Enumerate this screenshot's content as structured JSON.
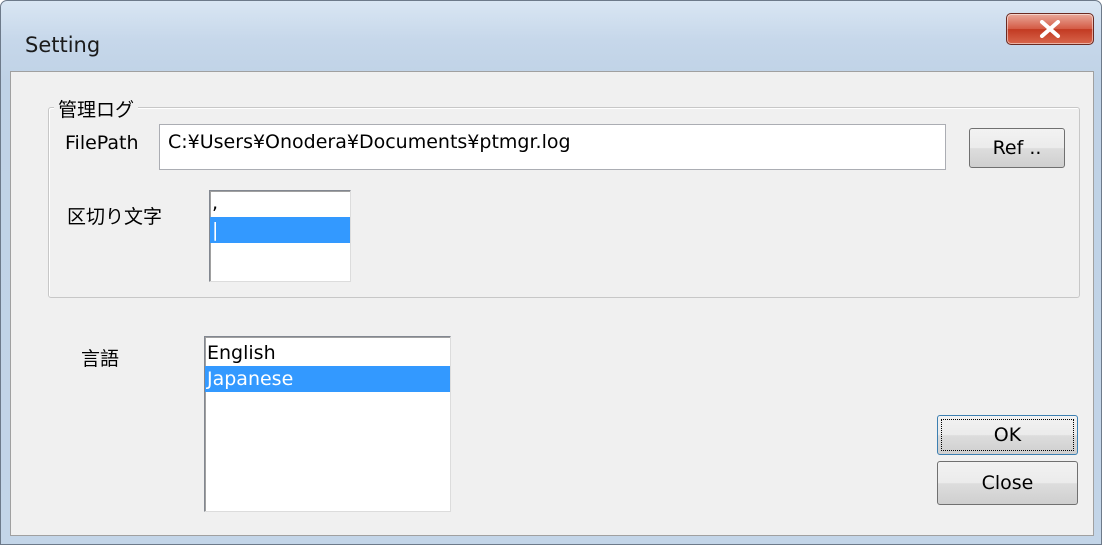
{
  "window": {
    "title": "Setting"
  },
  "log_group": {
    "legend": "管理ログ",
    "filepath_label": "FilePath",
    "filepath_value": "C:¥Users¥Onodera¥Documents¥ptmgr.log",
    "ref_button": "Ref ..",
    "delimiter_label": "区切り文字",
    "delimiter_options": [
      ",",
      "|",
      ""
    ],
    "delimiter_selected": 1
  },
  "language": {
    "label": "言語",
    "options": [
      "English",
      "Japanese"
    ],
    "selected": 1
  },
  "buttons": {
    "ok": "OK",
    "close": "Close"
  },
  "colors": {
    "selection": "#3399ff",
    "close_button": "#c7452f"
  }
}
